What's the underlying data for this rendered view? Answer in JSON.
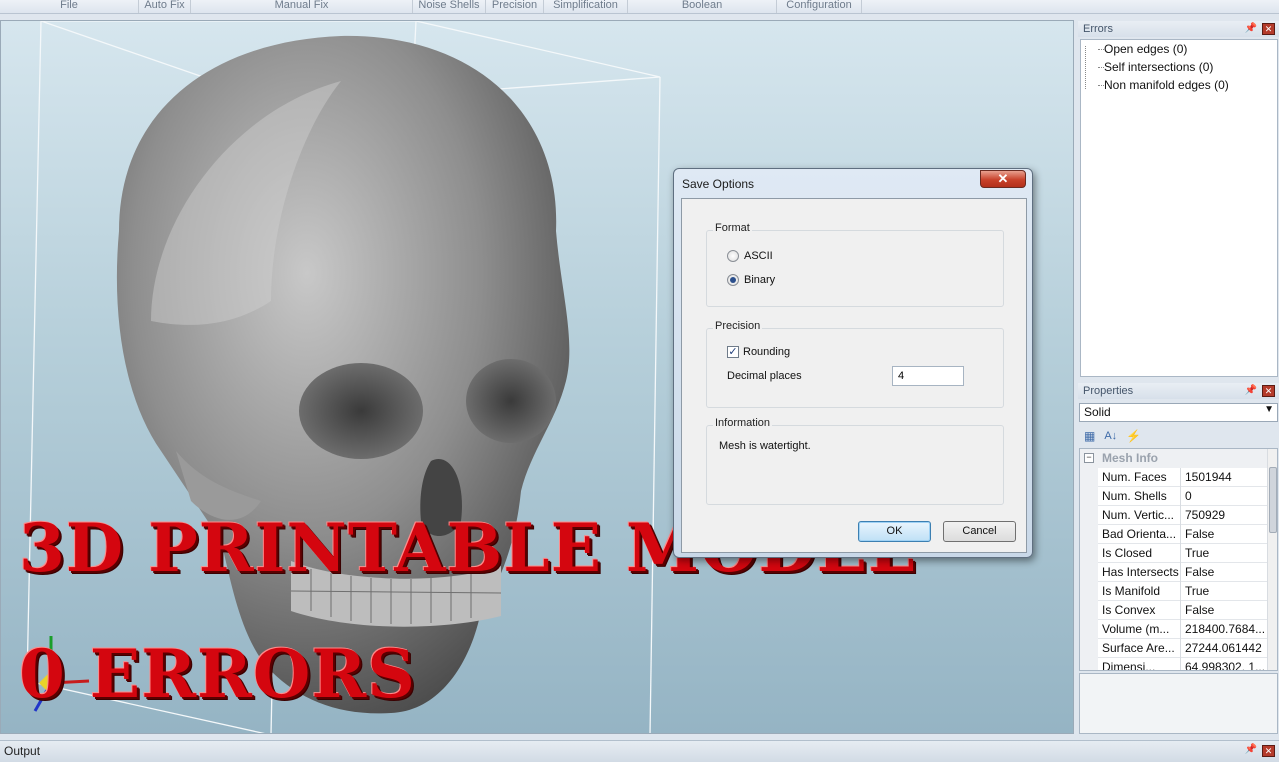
{
  "ribbon": {
    "groups": [
      "File",
      "Auto Fix",
      "Manual Fix",
      "Noise Shells",
      "Precision",
      "Simplification",
      "Boolean",
      "Configuration"
    ]
  },
  "overlay": {
    "line1": "3D PRINTABLE MODEL",
    "line2": "0 ERRORS"
  },
  "dialog": {
    "title": "Save Options",
    "close_icon": "close-icon",
    "format": {
      "label": "Format",
      "options": [
        "ASCII",
        "Binary"
      ],
      "selected": "Binary"
    },
    "precision": {
      "label": "Precision",
      "rounding_label": "Rounding",
      "rounding_checked": true,
      "decimal_label": "Decimal places",
      "decimal_value": "4"
    },
    "information": {
      "label": "Information",
      "text": "Mesh is watertight."
    },
    "ok_label": "OK",
    "cancel_label": "Cancel"
  },
  "errors_panel": {
    "title": "Errors",
    "items": [
      "Open edges (0)",
      "Self intersections (0)",
      "Non manifold edges (0)"
    ]
  },
  "properties_panel": {
    "title": "Properties",
    "selected_object": "Solid",
    "category": "Mesh Info",
    "rows": [
      {
        "name": "Num. Faces",
        "value": "1501944"
      },
      {
        "name": "Num. Shells",
        "value": "0"
      },
      {
        "name": "Num. Vertic...",
        "value": "750929"
      },
      {
        "name": "Bad Orienta...",
        "value": "False"
      },
      {
        "name": "Is Closed",
        "value": "True"
      },
      {
        "name": "Has Intersects",
        "value": "False"
      },
      {
        "name": "Is Manifold",
        "value": "True"
      },
      {
        "name": "Is Convex",
        "value": "False"
      },
      {
        "name": "Volume (m...",
        "value": "218400.7684..."
      },
      {
        "name": "Surface Are...",
        "value": "27244.061442"
      },
      {
        "name": "Dimensi...",
        "value": "64.998302, 1..."
      }
    ]
  },
  "output_panel": {
    "title": "Output"
  },
  "colors": {
    "overlay_red": "#d4060f",
    "close_red": "#c8412a"
  }
}
